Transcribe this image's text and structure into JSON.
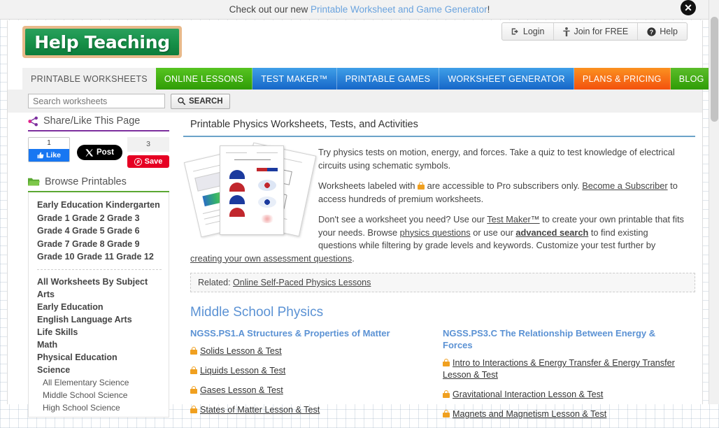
{
  "promo": {
    "prefix": "Check out our new ",
    "link": "Printable Worksheet and Game Generator",
    "suffix": "!",
    "close_label": "✕"
  },
  "header": {
    "logo_text": "Help Teaching",
    "account_buttons": [
      {
        "label": "Login",
        "icon": "login-icon"
      },
      {
        "label": "Join for FREE",
        "icon": "person-icon"
      },
      {
        "label": "Help",
        "icon": "question-circle-icon"
      }
    ]
  },
  "nav": {
    "tabs": [
      {
        "label": "PRINTABLE WORKSHEETS",
        "style": "active"
      },
      {
        "label": "ONLINE LESSONS",
        "style": "green"
      },
      {
        "label": "TEST MAKER™",
        "style": "blue"
      },
      {
        "label": "PRINTABLE GAMES",
        "style": "blue"
      },
      {
        "label": "WORKSHEET GENERATOR",
        "style": "blue"
      },
      {
        "label": "PLANS & PRICING",
        "style": "orange"
      },
      {
        "label": "BLOG",
        "style": "green2"
      }
    ]
  },
  "search": {
    "placeholder": "Search worksheets",
    "value": "",
    "button_label": "SEARCH"
  },
  "sidebar": {
    "share_panel": {
      "title": "Share/Like This Page",
      "icon": "share-icon",
      "facebook": {
        "count": "1",
        "label": "Like",
        "icon": "thumbs-up-icon"
      },
      "x": {
        "label": "Post",
        "icon": "x-logo-icon"
      },
      "pinterest": {
        "count": "3",
        "label": "Save",
        "icon": "pinterest-icon"
      }
    },
    "browse_panel": {
      "title": "Browse Printables",
      "icon": "folder-icon",
      "grade_lines": [
        "Early Education Kindergarten",
        "Grade 1 Grade 2 Grade 3",
        "Grade 4 Grade 5 Grade 6",
        "Grade 7 Grade 8 Grade 9",
        "Grade 10 Grade 11 Grade 12"
      ],
      "subjects": [
        {
          "label": "All Worksheets By Subject",
          "level": "top"
        },
        {
          "label": "Arts",
          "level": "top"
        },
        {
          "label": "Early Education",
          "level": "top"
        },
        {
          "label": "English Language Arts",
          "level": "top"
        },
        {
          "label": "Life Skills",
          "level": "top"
        },
        {
          "label": "Math",
          "level": "top"
        },
        {
          "label": "Physical Education",
          "level": "top"
        },
        {
          "label": "Science",
          "level": "top"
        },
        {
          "label": "All Elementary Science",
          "level": "sub"
        },
        {
          "label": "Middle School Science",
          "level": "sub"
        },
        {
          "label": "High School Science",
          "level": "sub"
        }
      ]
    }
  },
  "main": {
    "page_title": "Printable Physics Worksheets, Tests, and Activities",
    "thumbnail_alt": "physics worksheets stack",
    "paragraphs": {
      "p1": "Try physics tests on motion, energy, and forces. Take a quiz to test knowledge of electrical circuits using schematic symbols.",
      "p2_before": "Worksheets labeled with ",
      "p2_mid": " are accessible to Pro subscribers only. ",
      "p2_link": "Become a Subscriber",
      "p2_after": " to access hundreds of premium worksheets.",
      "p3_a": "Don't see a worksheet you need? Use our ",
      "p3_link1": "Test Maker™",
      "p3_b": " to create your own printable that fits your needs. Browse ",
      "p3_link2": "physics questions",
      "p3_c": " or use our ",
      "p3_link3": "advanced search",
      "p3_d": " to find existing questions while filtering by grade levels and keywords. Customize your test further by ",
      "p3_link4": "creating your own assessment questions",
      "p3_e": "."
    },
    "related": {
      "label": "Related:",
      "link": "Online Self-Paced Physics Lessons"
    },
    "section_title": "Middle School Physics",
    "columns": [
      {
        "heading": "NGSS.PS1.A Structures & Properties of Matter",
        "items": [
          {
            "label": "Solids Lesson & Test",
            "locked": true
          },
          {
            "label": "Liquids Lesson & Test",
            "locked": true
          },
          {
            "label": "Gases Lesson & Test",
            "locked": true
          },
          {
            "label": "States of Matter Lesson & Test",
            "locked": true
          }
        ]
      },
      {
        "heading": "NGSS.PS3.C The Relationship Between Energy & Forces",
        "items": [
          {
            "label": "Intro to Interactions & Energy Transfer & Energy Transfer Lesson & Test",
            "locked": true
          },
          {
            "label": "Gravitational Interaction Lesson & Test",
            "locked": true
          },
          {
            "label": "Magnets and Magnetism Lesson & Test",
            "locked": true
          }
        ]
      }
    ]
  },
  "colors": {
    "nav_green": "#2f9c06",
    "nav_blue": "#1666c8",
    "nav_orange": "#f3510d",
    "accent_blue": "#5b92d4",
    "lock_orange": "#f0a020",
    "share_purple": "#7c2f9e",
    "browse_green": "#5aa832",
    "facebook_blue": "#1877f2",
    "pinterest_red": "#e60023"
  }
}
